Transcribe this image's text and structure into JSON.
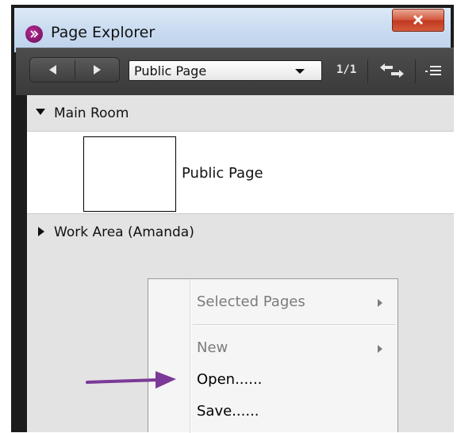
{
  "window": {
    "title": "Page Explorer",
    "close_label": "X"
  },
  "toolbar": {
    "page_select_value": "Public Page",
    "page_count": "1/1"
  },
  "sections": {
    "main_room": {
      "label": "Main Room",
      "pages": [
        {
          "label": "Public Page"
        }
      ]
    },
    "work_area": {
      "label": "Work Area (Amanda)"
    }
  },
  "context_menu": {
    "items": [
      {
        "label": "Selected Pages",
        "enabled": false,
        "submenu": true
      },
      {
        "label": "New",
        "enabled": false,
        "submenu": true
      },
      {
        "label": "Open......",
        "enabled": true,
        "submenu": false
      },
      {
        "label": "Save......",
        "enabled": true,
        "submenu": false
      }
    ]
  },
  "annotation": {
    "arrow_color": "#7b3a97"
  }
}
